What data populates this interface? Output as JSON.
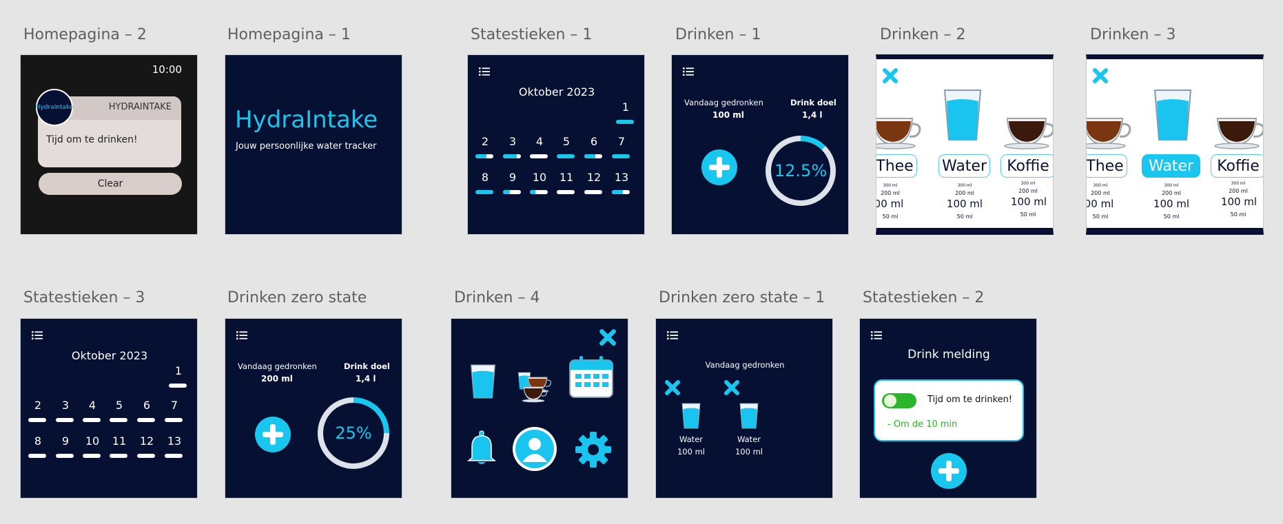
{
  "frames": {
    "homepagina2": {
      "title": "Homepagina – 2",
      "time": "10:00",
      "app_name": "HYDRAINTAKE",
      "logo_text": "HydraIntake",
      "message": "Tijd om te drinken!",
      "clear_label": "Clear"
    },
    "homepagina1": {
      "title": "Homepagina – 1",
      "app_title": "HydraIntake",
      "subtitle": "Jouw persoonlijke water tracker"
    },
    "statistieken1": {
      "title": "Statestieken – 1",
      "month": "Oktober 2023",
      "days": [
        {
          "label": "1",
          "progress": 1.0
        },
        {
          "label": "2",
          "progress": 0.6
        },
        {
          "label": "3",
          "progress": 0.75
        },
        {
          "label": "4",
          "progress": 0.0
        },
        {
          "label": "5",
          "progress": 1.0
        },
        {
          "label": "6",
          "progress": 0.6
        },
        {
          "label": "7",
          "progress": 1.0
        },
        {
          "label": "8",
          "progress": 1.0
        },
        {
          "label": "9",
          "progress": 0.4
        },
        {
          "label": "10",
          "progress": 0.3
        },
        {
          "label": "11",
          "progress": 0.0
        },
        {
          "label": "12",
          "progress": 0.0
        },
        {
          "label": "13",
          "progress": 0.6
        }
      ]
    },
    "drinken1": {
      "title": "Drinken – 1",
      "today_label": "Vandaag gedronken",
      "today_value": "100 ml",
      "goal_label": "Drink doel",
      "goal_value": "1,4 l",
      "percent": "12.5%",
      "progress": 0.125
    },
    "drinken2": {
      "title": "Drinken – 2",
      "drinks": [
        "Thee",
        "Water",
        "Koffie"
      ],
      "amounts_small": [
        "300 ml",
        "300 ml",
        "300 ml"
      ],
      "amounts_mid": [
        "200 ml",
        "200 ml",
        "200 ml"
      ],
      "amounts_main": [
        "00 ml",
        "100 ml",
        "100 ml"
      ],
      "amounts_low": [
        "50 ml",
        "50 ml",
        "50 ml"
      ]
    },
    "drinken3": {
      "title": "Drinken – 3",
      "drinks": [
        "Thee",
        "Water",
        "Koffie"
      ],
      "selected": "Water",
      "amounts_small": [
        "300 ml",
        "300 ml",
        "300 ml"
      ],
      "amounts_mid": [
        "200 ml",
        "200 ml",
        "200 ml"
      ],
      "amounts_main": [
        "00 ml",
        "100 ml",
        "100 ml"
      ],
      "amounts_low": [
        "50 ml",
        "50 ml",
        "50 ml"
      ]
    },
    "statistieken3": {
      "title": "Statestieken – 3",
      "month": "Oktober 2023",
      "days": [
        "1",
        "2",
        "3",
        "4",
        "5",
        "6",
        "7",
        "8",
        "9",
        "10",
        "11",
        "12",
        "13"
      ]
    },
    "drinkenZero": {
      "title": "Drinken zero state",
      "today_label": "Vandaag gedronken",
      "today_value": "200 ml",
      "goal_label": "Drink doel",
      "goal_value": "1,4 l",
      "percent": "25%",
      "progress": 0.25
    },
    "drinken4": {
      "title": "Drinken – 4"
    },
    "drinkenZero1": {
      "title": "Drinken zero state – 1",
      "today_label": "Vandaag gedronken",
      "entries": [
        {
          "name": "Water",
          "amount": "100 ml"
        },
        {
          "name": "Water",
          "amount": "100 ml"
        }
      ]
    },
    "statistieken2": {
      "title": "Statestieken – 2",
      "heading": "Drink melding",
      "reminder": "Tijd om te drinken!",
      "interval": "- Om de 10 min",
      "toggle_on": true
    }
  },
  "colors": {
    "background": "#e5e5e5",
    "navy": "#051033",
    "accent": "#18c6ee",
    "green": "#2bb52b"
  },
  "icons": [
    "menu-icon",
    "plus-icon",
    "close-icon",
    "calendar-icon",
    "bell-icon",
    "user-icon",
    "settings-icon",
    "water-glass-icon",
    "tea-cup-icon",
    "coffee-cup-icon"
  ]
}
